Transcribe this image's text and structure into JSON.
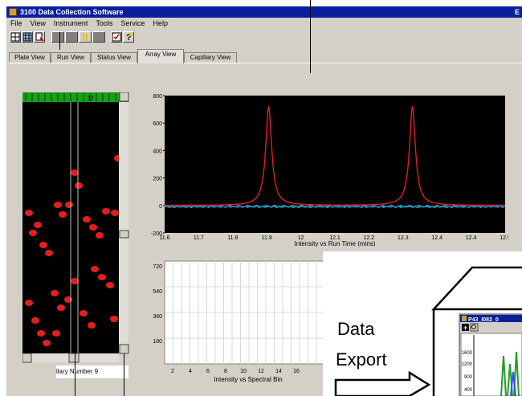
{
  "window": {
    "title": "3100 Data Collection Software",
    "title_right": "E",
    "menu": [
      "File",
      "View",
      "Instrument",
      "Tools",
      "Service",
      "Help"
    ]
  },
  "tabs": [
    "Plate View",
    "Run View",
    "Status View",
    "Array View",
    "Capillary View"
  ],
  "active_tab": "Array View",
  "array_panel": {
    "label": "llary Number 9",
    "header_marker": "1/"
  },
  "icons": [
    "plate-icon",
    "grid-icon",
    "wand-icon",
    "stop-icon",
    "pause-icon",
    "run-icon",
    "checklist-icon",
    "help-icon",
    "document-icon",
    "magnify-icon",
    "arrow-right-icon"
  ],
  "colors": {
    "title_bar": "#0a1f9c",
    "plot_bg": "#000000",
    "peak_trace": "#e02020",
    "array_band": "#ff2020",
    "header_green": "#18a018"
  },
  "chart_data": [
    {
      "type": "line",
      "xlabel": "Intensity vs Run Time (mins)",
      "ylabel": "",
      "x_ticks": [
        "11.6",
        "11.7",
        "11.8",
        "11.9",
        "12",
        "12.1",
        "12.2",
        "12.3",
        "12.4",
        "12.4",
        "12.5"
      ],
      "y_ticks": [
        "800",
        "600",
        "400",
        "200",
        "0",
        "-200"
      ],
      "xlim": [
        11.6,
        12.5
      ],
      "ylim": [
        -200,
        800
      ],
      "grid": false,
      "series": [
        {
          "color": "#e02020",
          "peaks": [
            {
              "x": 11.875,
              "y": 720
            },
            {
              "x": 12.255,
              "y": 720
            }
          ],
          "baseline": 0
        },
        {
          "color": "#20e0e0",
          "baseline": -5
        },
        {
          "color": "#20e020",
          "baseline": -10
        },
        {
          "color": "#3050ff",
          "baseline": -8
        }
      ]
    },
    {
      "type": "line",
      "xlabel": "Intensity vs Spectral Bin",
      "ylabel": "",
      "x_ticks": [
        "2",
        "4",
        "6",
        "8",
        "10",
        "12",
        "14",
        "16"
      ],
      "y_ticks": [
        "720",
        "540",
        "360",
        "180"
      ],
      "ylim": [
        0,
        720
      ],
      "grid": true,
      "series": []
    }
  ],
  "export_panel": {
    "label_line1": "Data",
    "label_line2": "Export",
    "window_title": "P43_I082_0",
    "ticks": [
      "1600",
      "1200",
      "900",
      "400"
    ]
  }
}
